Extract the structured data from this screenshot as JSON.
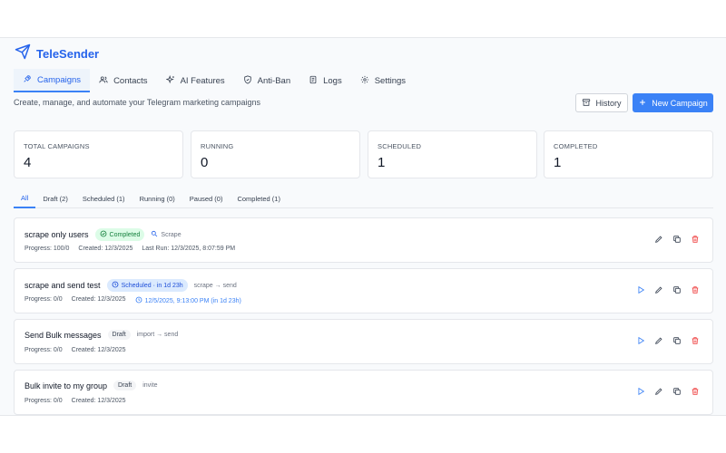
{
  "app": {
    "name": "TeleSender"
  },
  "tabs": [
    {
      "label": "Campaigns",
      "icon": "rocket-icon"
    },
    {
      "label": "Contacts",
      "icon": "users-icon"
    },
    {
      "label": "AI Features",
      "icon": "sparkles-icon"
    },
    {
      "label": "Anti-Ban",
      "icon": "shield-icon"
    },
    {
      "label": "Logs",
      "icon": "document-icon"
    },
    {
      "label": "Settings",
      "icon": "gear-icon"
    }
  ],
  "header": {
    "subtitle": "Create, manage, and automate your Telegram marketing campaigns",
    "history_label": "History",
    "new_campaign_label": "New Campaign"
  },
  "stats": [
    {
      "label": "Total Campaigns",
      "value": "4"
    },
    {
      "label": "Running",
      "value": "0"
    },
    {
      "label": "Scheduled",
      "value": "1"
    },
    {
      "label": "Completed",
      "value": "1"
    }
  ],
  "filters": [
    "All",
    "Draft (2)",
    "Scheduled (1)",
    "Running (0)",
    "Paused (0)",
    "Completed (1)"
  ],
  "campaigns": [
    {
      "name": "scrape only users",
      "status": "Completed",
      "mode": "Scrape",
      "progress": "Progress: 100/0",
      "created": "Created: 12/3/2025",
      "extra": "Last Run: 12/3/2025, 8:07:59 PM"
    },
    {
      "name": "scrape and send test",
      "status": "Scheduled · in 1d 23h",
      "mode": "scrape → send",
      "progress": "Progress: 0/0",
      "created": "Created: 12/3/2025",
      "extra": "12/5/2025, 9:13:00 PM (in 1d 23h)"
    },
    {
      "name": "Send Bulk messages",
      "status": "Draft",
      "mode": "import → send",
      "progress": "Progress: 0/0",
      "created": "Created: 12/3/2025",
      "extra": ""
    },
    {
      "name": "Bulk invite to my group",
      "status": "Draft",
      "mode": "invite",
      "progress": "Progress: 0/0",
      "created": "Created: 12/3/2025",
      "extra": ""
    }
  ],
  "colors": {
    "accent": "#3b82f6",
    "success": "#15803d",
    "danger": "#ef4444"
  }
}
